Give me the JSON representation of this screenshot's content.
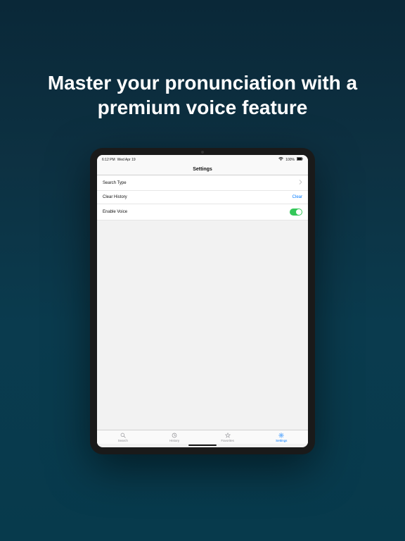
{
  "headline": "Master your pronunciation with a premium voice feature",
  "status_bar": {
    "time": "6:12 PM",
    "date": "Wed Apr 19",
    "wifi": "wifi",
    "battery": "100%"
  },
  "nav_title": "Settings",
  "settings": {
    "search_type_label": "Search Type",
    "clear_history_label": "Clear History",
    "clear_action": "Clear",
    "enable_voice_label": "Enable Voice",
    "enable_voice_on": true
  },
  "tabs": {
    "search": "Search",
    "history": "History",
    "favorites": "Favorites",
    "settings": "Settings"
  }
}
